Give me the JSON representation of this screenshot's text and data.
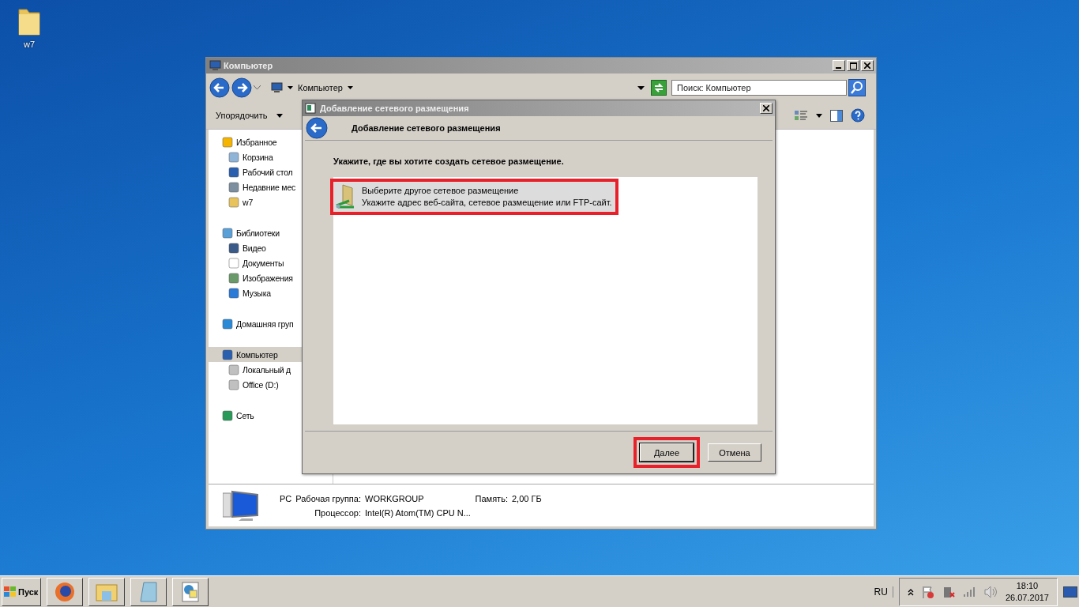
{
  "desktop": {
    "icons": [
      {
        "label": "w7"
      }
    ]
  },
  "explorer": {
    "title": "Компьютер",
    "address": {
      "crumbs": [
        "Компьютер"
      ]
    },
    "search": {
      "placeholder": "Поиск: Компьютер"
    },
    "toolbar": {
      "organize": "Упорядочить"
    },
    "sidebar": {
      "groups": [
        {
          "label": "Избранное",
          "kind": "star",
          "selected": false,
          "children": [
            {
              "label": "Корзина",
              "kind": "bin",
              "selected": false
            },
            {
              "label": "Рабочий стол",
              "kind": "monitor",
              "selected": false
            },
            {
              "label": "Недавние мес",
              "kind": "recent",
              "selected": false
            },
            {
              "label": "w7",
              "kind": "folder",
              "selected": false
            }
          ]
        },
        {
          "label": "Библиотеки",
          "kind": "library",
          "selected": false,
          "children": [
            {
              "label": "Видео",
              "kind": "film",
              "selected": false
            },
            {
              "label": "Документы",
              "kind": "doc",
              "selected": false
            },
            {
              "label": "Изображения",
              "kind": "image",
              "selected": false
            },
            {
              "label": "Музыка",
              "kind": "note",
              "selected": false
            }
          ]
        },
        {
          "label": "Домашняя груп",
          "kind": "homegroup",
          "selected": false
        },
        {
          "label": "Компьютер",
          "kind": "monitor",
          "selected": true,
          "children": [
            {
              "label": "Локальный д",
              "kind": "drive",
              "selected": false
            },
            {
              "label": "Office (D:)",
              "kind": "drive",
              "selected": false
            }
          ]
        },
        {
          "label": "Сеть",
          "kind": "network",
          "selected": false
        }
      ]
    },
    "details": {
      "name": "PC",
      "workgroup_label": "Рабочая группа:",
      "workgroup": "WORKGROUP",
      "memory_label": "Память:",
      "memory": "2,00 ГБ",
      "cpu_label": "Процессор:",
      "cpu": "Intel(R) Atom(TM) CPU N..."
    }
  },
  "dialog": {
    "title": "Добавление сетевого размещения",
    "heading": "Добавление сетевого размещения",
    "prompt": "Укажите, где вы хотите создать сетевое размещение.",
    "options": [
      {
        "title": "Выберите другое сетевое размещение",
        "description": "Укажите адрес веб-сайта, сетевое размещение или FTP-сайт.",
        "selected": true,
        "highlighted": true
      }
    ],
    "buttons": [
      {
        "label": "Далее",
        "default": true,
        "highlighted": true
      },
      {
        "label": "Отмена",
        "default": false,
        "highlighted": false
      }
    ]
  },
  "taskbar": {
    "start": "Пуск",
    "language": "RU",
    "time": "18:10",
    "date": "26.07.2017"
  }
}
